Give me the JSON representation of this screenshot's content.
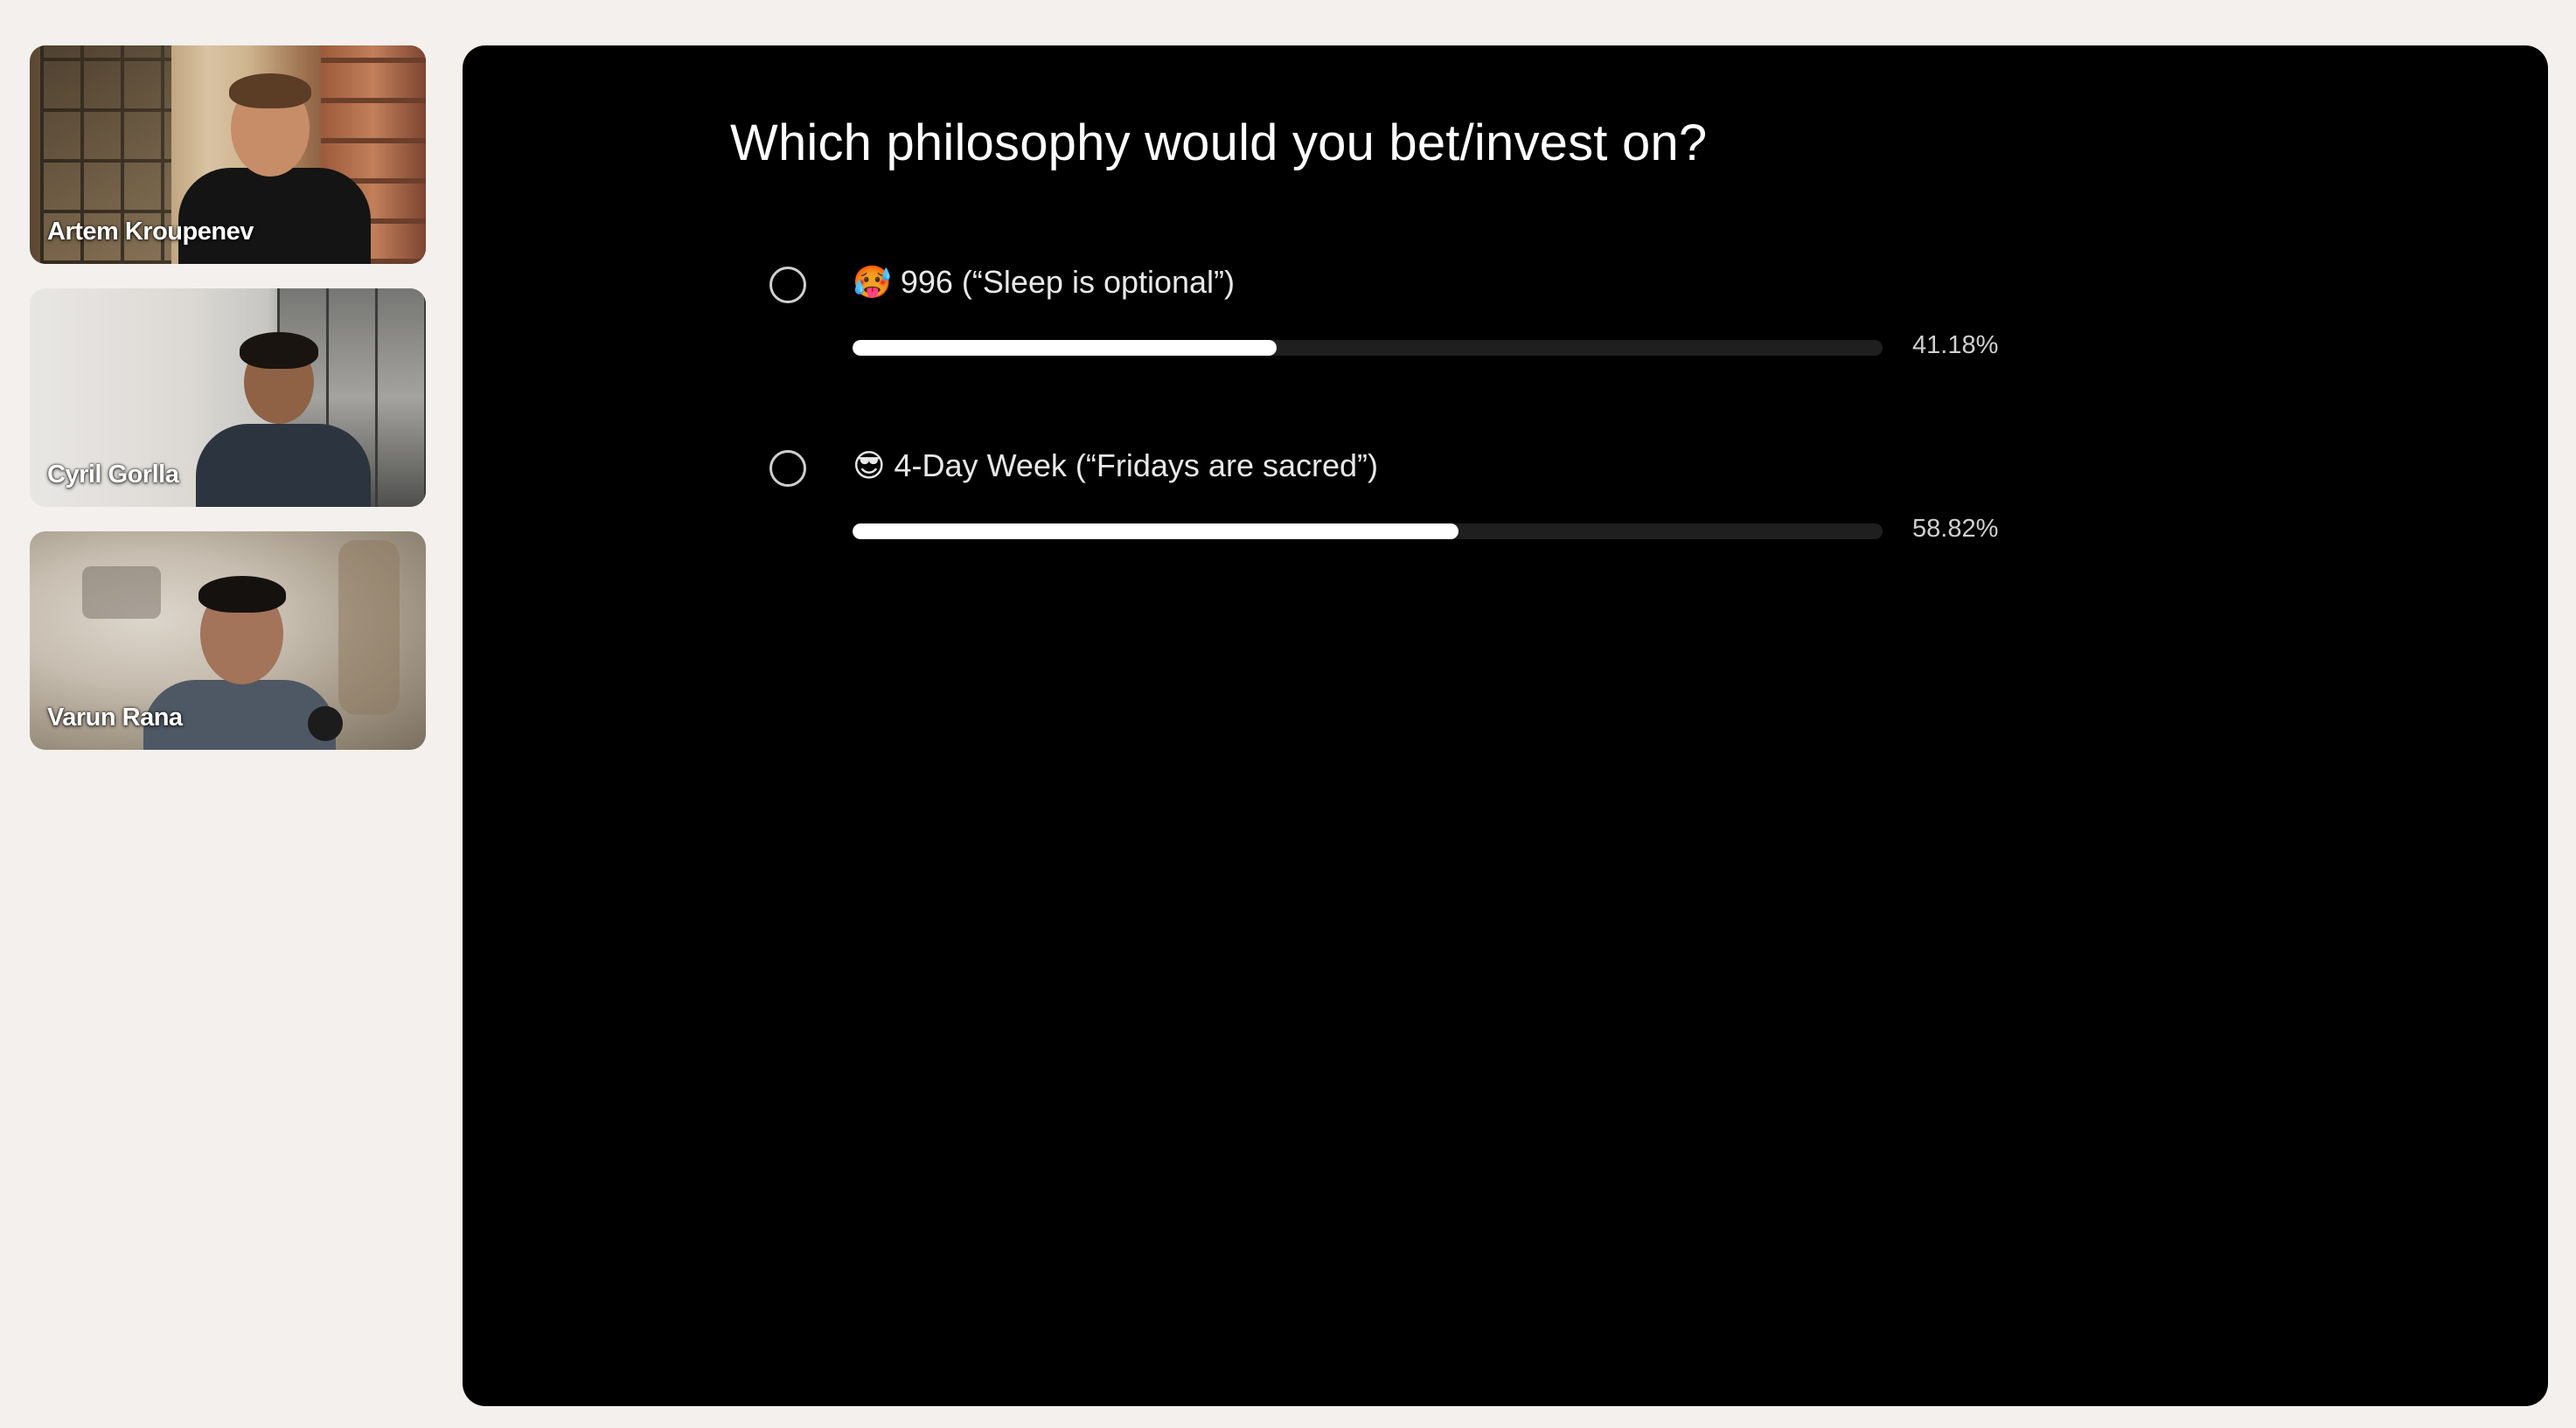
{
  "participants": [
    {
      "name": "Artem Kroupenev"
    },
    {
      "name": "Cyril Gorlla"
    },
    {
      "name": "Varun Rana"
    }
  ],
  "poll": {
    "question": "Which philosophy would you bet/invest on?",
    "options": [
      {
        "emoji": "🥵",
        "label": "996 (“Sleep is optional”)",
        "percent_label": "41.18%",
        "percent": 41.18
      },
      {
        "emoji": "😎",
        "label": "4-Day Week (“Fridays are sacred”)",
        "percent_label": "58.82%",
        "percent": 58.82
      }
    ]
  },
  "colors": {
    "background": "#f3f0ed",
    "panel": "#000000",
    "bar_fill": "#ffffff",
    "bar_track": "#1f1f1f"
  }
}
